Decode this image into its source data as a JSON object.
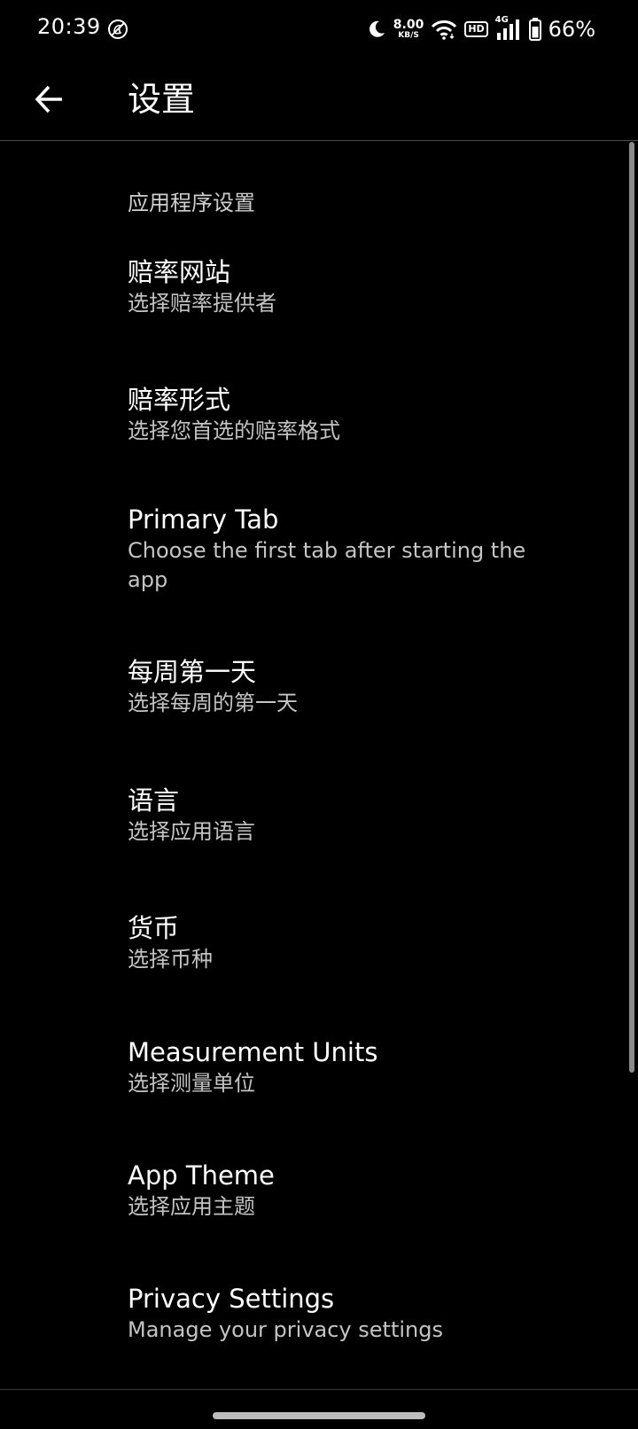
{
  "status_bar": {
    "time": "20:39",
    "net_speed_value": "8.00",
    "net_speed_unit": "KB/S",
    "hd_label": "HD",
    "network_type": "4G",
    "battery_percent": "66%",
    "icons": [
      "dnd-off-icon",
      "moon-icon",
      "wifi-icon",
      "hd-icon",
      "signal-icon",
      "battery-icon"
    ]
  },
  "app_bar": {
    "title": "设置",
    "back_icon": "arrow-left-icon"
  },
  "settings": {
    "section_header": "应用程序设置",
    "items": [
      {
        "title": "赔率网站",
        "summary": "选择赔率提供者"
      },
      {
        "title": "赔率形式",
        "summary": "选择您首选的赔率格式"
      },
      {
        "title": "Primary Tab",
        "summary": "Choose the first tab after starting the app"
      },
      {
        "title": "每周第一天",
        "summary": "选择每周的第一天"
      },
      {
        "title": "语言",
        "summary": "选择应用语言"
      },
      {
        "title": "货币",
        "summary": "选择币种"
      },
      {
        "title": "Measurement Units",
        "summary": "选择测量单位"
      },
      {
        "title": "App Theme",
        "summary": "选择应用主题"
      },
      {
        "title": "Privacy Settings",
        "summary": "Manage your privacy settings"
      }
    ]
  },
  "colors": {
    "background": "#000000",
    "title_text": "#ffffff",
    "summary_text": "#c4c4c4",
    "divider": "#4a4a4a"
  }
}
